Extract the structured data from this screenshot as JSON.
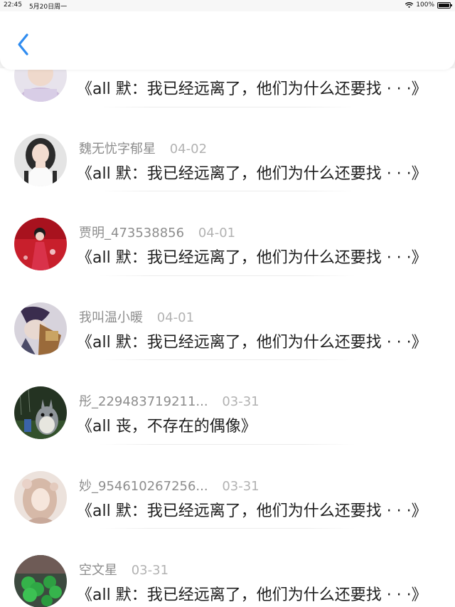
{
  "status_bar": {
    "time": "22:45",
    "date": "5月20日周一",
    "battery": "100%"
  },
  "nav": {
    "back_icon": "chevron-left-icon",
    "accent_color": "#2f8cf0"
  },
  "items": [
    {
      "username": "",
      "date": "",
      "title": "《all 默：我已经远离了，他们为什么还要找 · · ·》",
      "avatar": "avatar-partial"
    },
    {
      "username": "魏无忧字郁星",
      "date": "04-02",
      "title": "《all 默：我已经远离了，他们为什么还要找 · · ·》",
      "avatar": "avatar-girl-white-dress"
    },
    {
      "username": "贾明_473538856",
      "date": "04-01",
      "title": "《all 默：我已经远离了，他们为什么还要找 · · ·》",
      "avatar": "avatar-red-dress"
    },
    {
      "username": "我叫温小暖",
      "date": "04-01",
      "title": "《all 默：我已经远离了，他们为什么还要找 · · ·》",
      "avatar": "avatar-anime-character"
    },
    {
      "username": "彤_229483719211...",
      "date": "03-31",
      "title": "《all 丧，不存在的偶像》",
      "avatar": "avatar-totoro"
    },
    {
      "username": "妙_954610267256...",
      "date": "03-31",
      "title": "《all 默：我已经远离了，他们为什么还要找 · · ·》",
      "avatar": "avatar-painted-girl"
    },
    {
      "username": "空文星",
      "date": "03-31",
      "title": "《all 默：我已经远离了，他们为什么还要找 · · ·》",
      "avatar": "avatar-clover"
    }
  ]
}
